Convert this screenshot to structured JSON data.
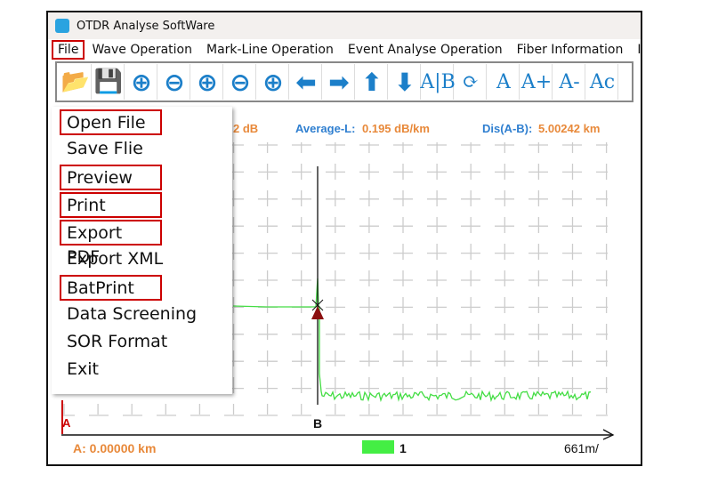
{
  "window": {
    "title": "OTDR Analyse SoftWare"
  },
  "menubar": [
    "File",
    "Wave Operation",
    "Mark-Line Operation",
    "Event Analyse Operation",
    "Fiber Information",
    "Int"
  ],
  "toolbar": [
    {
      "icon": "open-folder-icon",
      "glyph": "📂"
    },
    {
      "icon": "save-icon",
      "glyph": "💾"
    },
    {
      "icon": "zoom-in-horizontal-icon",
      "glyph": "⊕"
    },
    {
      "icon": "zoom-out-horizontal-icon",
      "glyph": "⊖"
    },
    {
      "icon": "zoom-in-vertical-icon",
      "glyph": "⊕"
    },
    {
      "icon": "zoom-out-vertical-icon",
      "glyph": "⊖"
    },
    {
      "icon": "zoom-in-icon",
      "glyph": "⊕"
    },
    {
      "icon": "arrow-left-icon",
      "glyph": "⬅"
    },
    {
      "icon": "arrow-right-icon",
      "glyph": "➡"
    },
    {
      "icon": "arrow-up-icon",
      "glyph": "⬆"
    },
    {
      "icon": "arrow-down-icon",
      "glyph": "⬇"
    },
    {
      "icon": "ab-marker-icon",
      "glyph": "A|B"
    },
    {
      "icon": "refresh-icon",
      "glyph": "⟳"
    },
    {
      "icon": "font-icon",
      "glyph": "A"
    },
    {
      "icon": "font-increase-icon",
      "glyph": "A+"
    },
    {
      "icon": "font-decrease-icon",
      "glyph": "A-"
    },
    {
      "icon": "font-color-icon",
      "glyph": "Ac"
    }
  ],
  "file_menu": [
    {
      "label": "Open File",
      "highlighted": true
    },
    {
      "label": "Save Flie",
      "highlighted": false
    },
    {
      "label": "Preview",
      "highlighted": true
    },
    {
      "label": "Print",
      "highlighted": true
    },
    {
      "label": "Export PDF",
      "highlighted": true
    },
    {
      "label": "Export XML",
      "highlighted": false
    },
    {
      "label": "BatPrint",
      "highlighted": true
    },
    {
      "label": "Data Screening",
      "highlighted": false
    },
    {
      "label": "SOR Format",
      "highlighted": false
    },
    {
      "label": "Exit",
      "highlighted": false
    }
  ],
  "stats": {
    "loss_partial": "2 dB",
    "avg_label": "Average-L:",
    "avg_value": "0.195 dB/km",
    "dis_label": "Dis(A-B):",
    "dis_value": "5.00242 km"
  },
  "markers": {
    "a": "A",
    "b": "B"
  },
  "footer": {
    "a_pos": "A: 0.00000 km",
    "trace_label": "1",
    "scale": "661m/"
  },
  "colors": {
    "trace": "#44dd44",
    "marker_a": "#cc0000",
    "highlight": "#cc0000",
    "accent_blue": "#2f7fd0",
    "accent_orange": "#e8893a"
  }
}
